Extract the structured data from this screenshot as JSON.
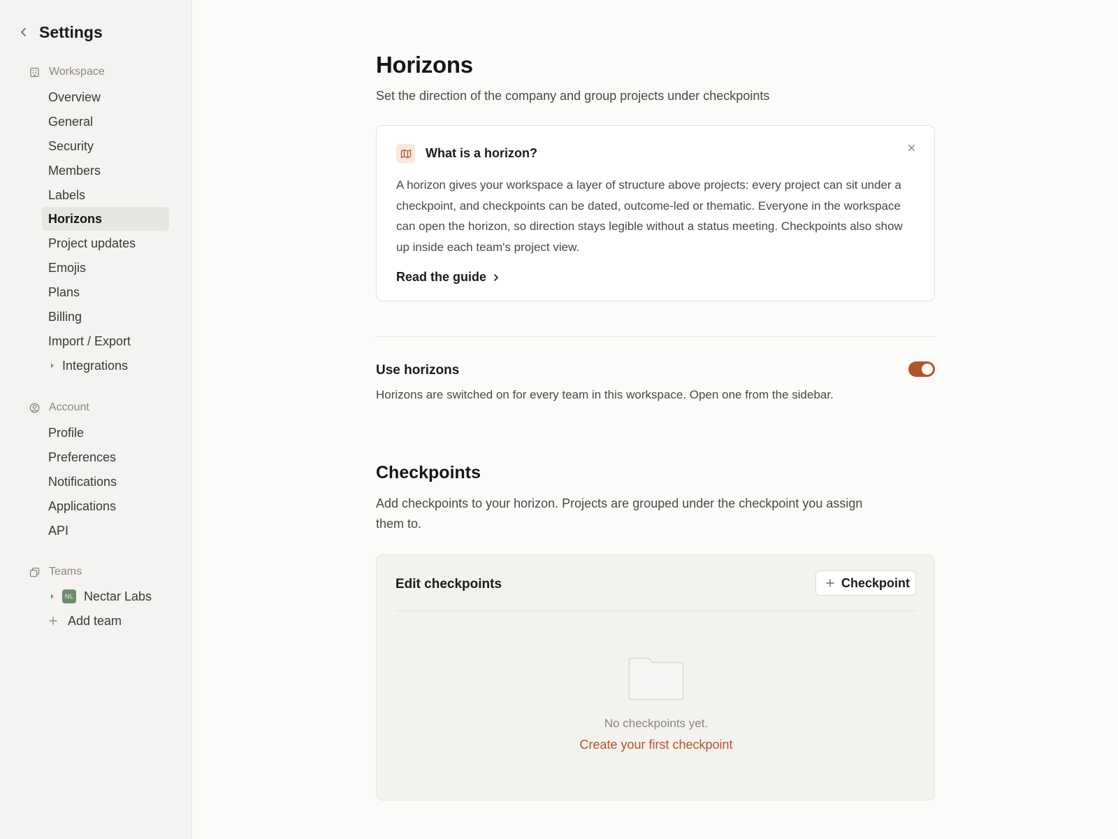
{
  "sidebar": {
    "title": "Settings",
    "workspace": {
      "label": "Workspace",
      "items": [
        "Overview",
        "General",
        "Security",
        "Members",
        "Labels",
        "Horizons",
        "Project updates",
        "Emojis",
        "Plans",
        "Billing",
        "Import / Export",
        "Integrations"
      ],
      "active": "Horizons"
    },
    "account": {
      "label": "Account",
      "items": [
        "Profile",
        "Preferences",
        "Notifications",
        "Applications",
        "API"
      ]
    },
    "teams": {
      "label": "Teams",
      "team_name": "Nectar Labs",
      "team_initials": "NL",
      "team_color": "#6b8f6b",
      "add_label": "Add team"
    }
  },
  "main": {
    "title": "Horizons",
    "subtitle": "Set the direction of the company and group projects under checkpoints",
    "info": {
      "icon": "map-icon",
      "title": "What is a horizon?",
      "body": "A horizon gives your workspace a layer of structure above projects: every project can sit under a checkpoint, and checkpoints can be dated, outcome-led or thematic. Everyone in the workspace can open the horizon, so direction stays legible without a status meeting. Checkpoints also show up inside each team's project view.",
      "link": "Read the guide"
    },
    "use_horizons": {
      "title": "Use horizons",
      "description": "Horizons are switched on for every team in this workspace. Open one from the sidebar.",
      "enabled": true
    },
    "checkpoints": {
      "title": "Checkpoints",
      "description": "Add checkpoints to your horizon. Projects are grouped under the checkpoint you assign them to.",
      "panel_title": "Edit checkpoints",
      "add_button": "Checkpoint",
      "empty_text": "No checkpoints yet.",
      "create_link": "Create your first checkpoint"
    }
  },
  "colors": {
    "accent": "#b4532a",
    "sidebar_bg": "#f4f3f1",
    "page_bg": "#fcfbf9"
  }
}
